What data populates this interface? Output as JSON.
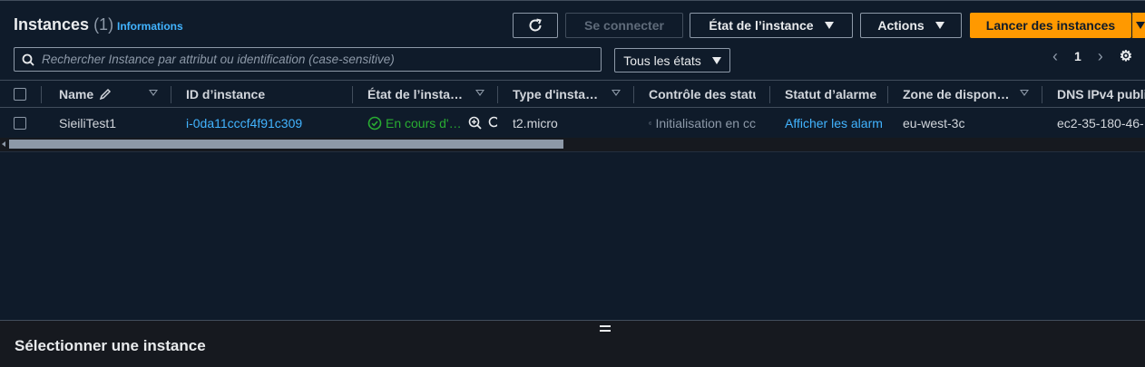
{
  "header": {
    "title": "Instances",
    "count": "(1)",
    "info_link": "Informations",
    "buttons": {
      "refresh_icon": "refresh-icon",
      "connect": "Se connecter",
      "instance_state": "État de l’instance",
      "actions": "Actions",
      "launch": "Lancer des instances"
    }
  },
  "search": {
    "placeholder": "Rechercher Instance par attribut ou identification (case-sensitive)",
    "value": ""
  },
  "state_filter": {
    "selected": "Tous les états"
  },
  "pagination": {
    "page": "1"
  },
  "table": {
    "columns": [
      "Name",
      "ID d’instance",
      "État de l’insta…",
      "Type d'insta…",
      "Contrôle des statu",
      "Statut d’alarme",
      "Zone de dispon…",
      "DNS IPv4 publi"
    ],
    "rows": [
      {
        "name": "SieiliTest1",
        "instance_id": "i-0da11cccf4f91c309",
        "state": "En cours d'…",
        "type": "t2.micro",
        "status_check": "Initialisation en cc",
        "alarm": "Afficher les alarm",
        "zone": "eu-west-3c",
        "dns": "ec2-35-180-46-"
      }
    ]
  },
  "detail_panel": {
    "title": "Sélectionner une instance"
  },
  "colors": {
    "background": "#0f1b2a",
    "accent": "#ff9900",
    "link": "#42b4ff",
    "running": "#29ad32"
  }
}
